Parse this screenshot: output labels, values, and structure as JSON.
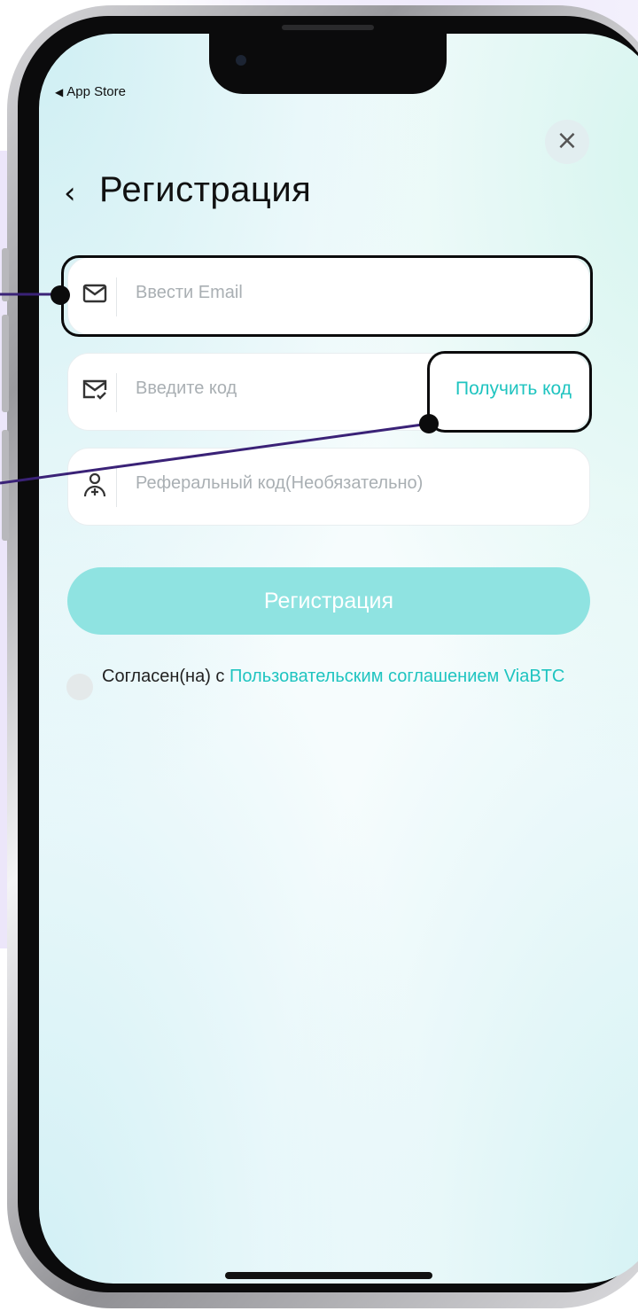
{
  "status_bar": {
    "back_label": "App Store"
  },
  "header": {
    "title": "Регистрация",
    "back_icon": "chevron-left-icon",
    "close_icon": "close-icon"
  },
  "form": {
    "email": {
      "placeholder": "Ввести Email",
      "icon": "mail-icon"
    },
    "code": {
      "placeholder": "Введите код",
      "icon": "mail-check-icon",
      "action_label": "Получить код"
    },
    "referral": {
      "placeholder": "Реферальный код(Необязательно)",
      "icon": "user-add-icon"
    },
    "submit_label": "Регистрация"
  },
  "agreement": {
    "prefix": "Согласен(на) с ",
    "link": "Пользовательским соглашением ViaBTC"
  },
  "colors": {
    "accent": "#1fc4c0",
    "button": "#8fe3e1",
    "annotation_line": "#3a2277"
  }
}
